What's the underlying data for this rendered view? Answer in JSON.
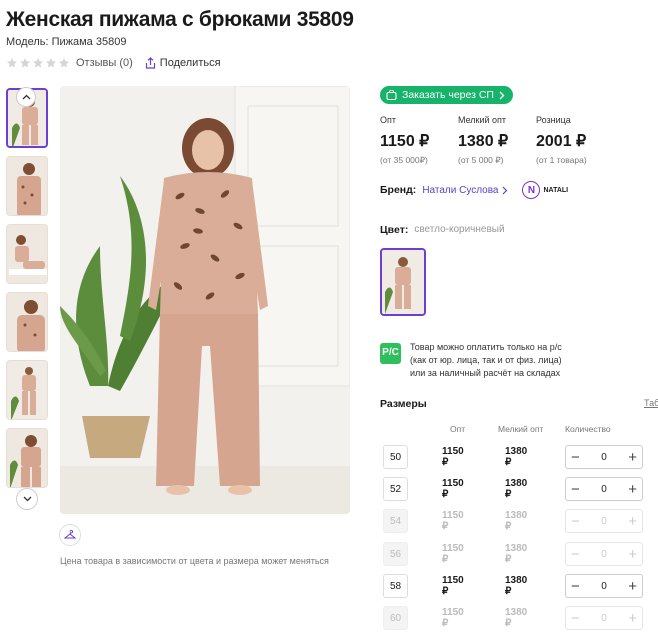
{
  "product": {
    "title": "Женская пижама с брюками 35809",
    "model": "Модель: Пижама 35809",
    "reviews": "Отзывы (0)",
    "share": "Поделиться",
    "price_note": "Цена товара в зависимости от цвета и размера может меняться"
  },
  "order_button": "Заказать через СП",
  "prices": [
    {
      "label": "Опт",
      "value": "1150 ₽",
      "note": "(от 35 000₽)"
    },
    {
      "label": "Мелкий опт",
      "value": "1380 ₽",
      "note": "(от 5 000 ₽)"
    },
    {
      "label": "Розница",
      "value": "2001 ₽",
      "note": "(от 1 товара)"
    }
  ],
  "brand": {
    "label": "Бренд:",
    "name": "Натали Суслова",
    "logo_text": "NATALI"
  },
  "color": {
    "label": "Цвет:",
    "value": "светло-коричневый"
  },
  "payment": {
    "icon_text": "P/C",
    "line1": "Товар можно оплатить только на р/с",
    "line2": "(как от юр. лица, так и от физ. лица)",
    "line3": "или за наличный расчёт на складах"
  },
  "sizes": {
    "title": "Размеры",
    "table_link": "Таб",
    "headers": {
      "opt": "Опт",
      "small_opt": "Мелкий опт",
      "qty": "Количество"
    },
    "rows": [
      {
        "size": "50",
        "opt": "1150 ₽",
        "small_opt": "1380 ₽",
        "qty": "0"
      },
      {
        "size": "52",
        "opt": "1150 ₽",
        "small_opt": "1380 ₽",
        "qty": "0"
      },
      {
        "size": "54",
        "opt": "1150 ₽",
        "small_opt": "1380 ₽",
        "qty": "0"
      },
      {
        "size": "56",
        "opt": "1150 ₽",
        "small_opt": "1380 ₽",
        "qty": "0"
      },
      {
        "size": "58",
        "opt": "1150 ₽",
        "small_opt": "1380 ₽",
        "qty": "0"
      },
      {
        "size": "60",
        "opt": "1150 ₽",
        "small_opt": "1380 ₽",
        "qty": "0"
      }
    ],
    "row_available": [
      true,
      true,
      false,
      false,
      true,
      false
    ]
  },
  "colors": {
    "accent": "#6b3fd3",
    "green": "#17b36a",
    "pajama": "#d9ad97"
  }
}
